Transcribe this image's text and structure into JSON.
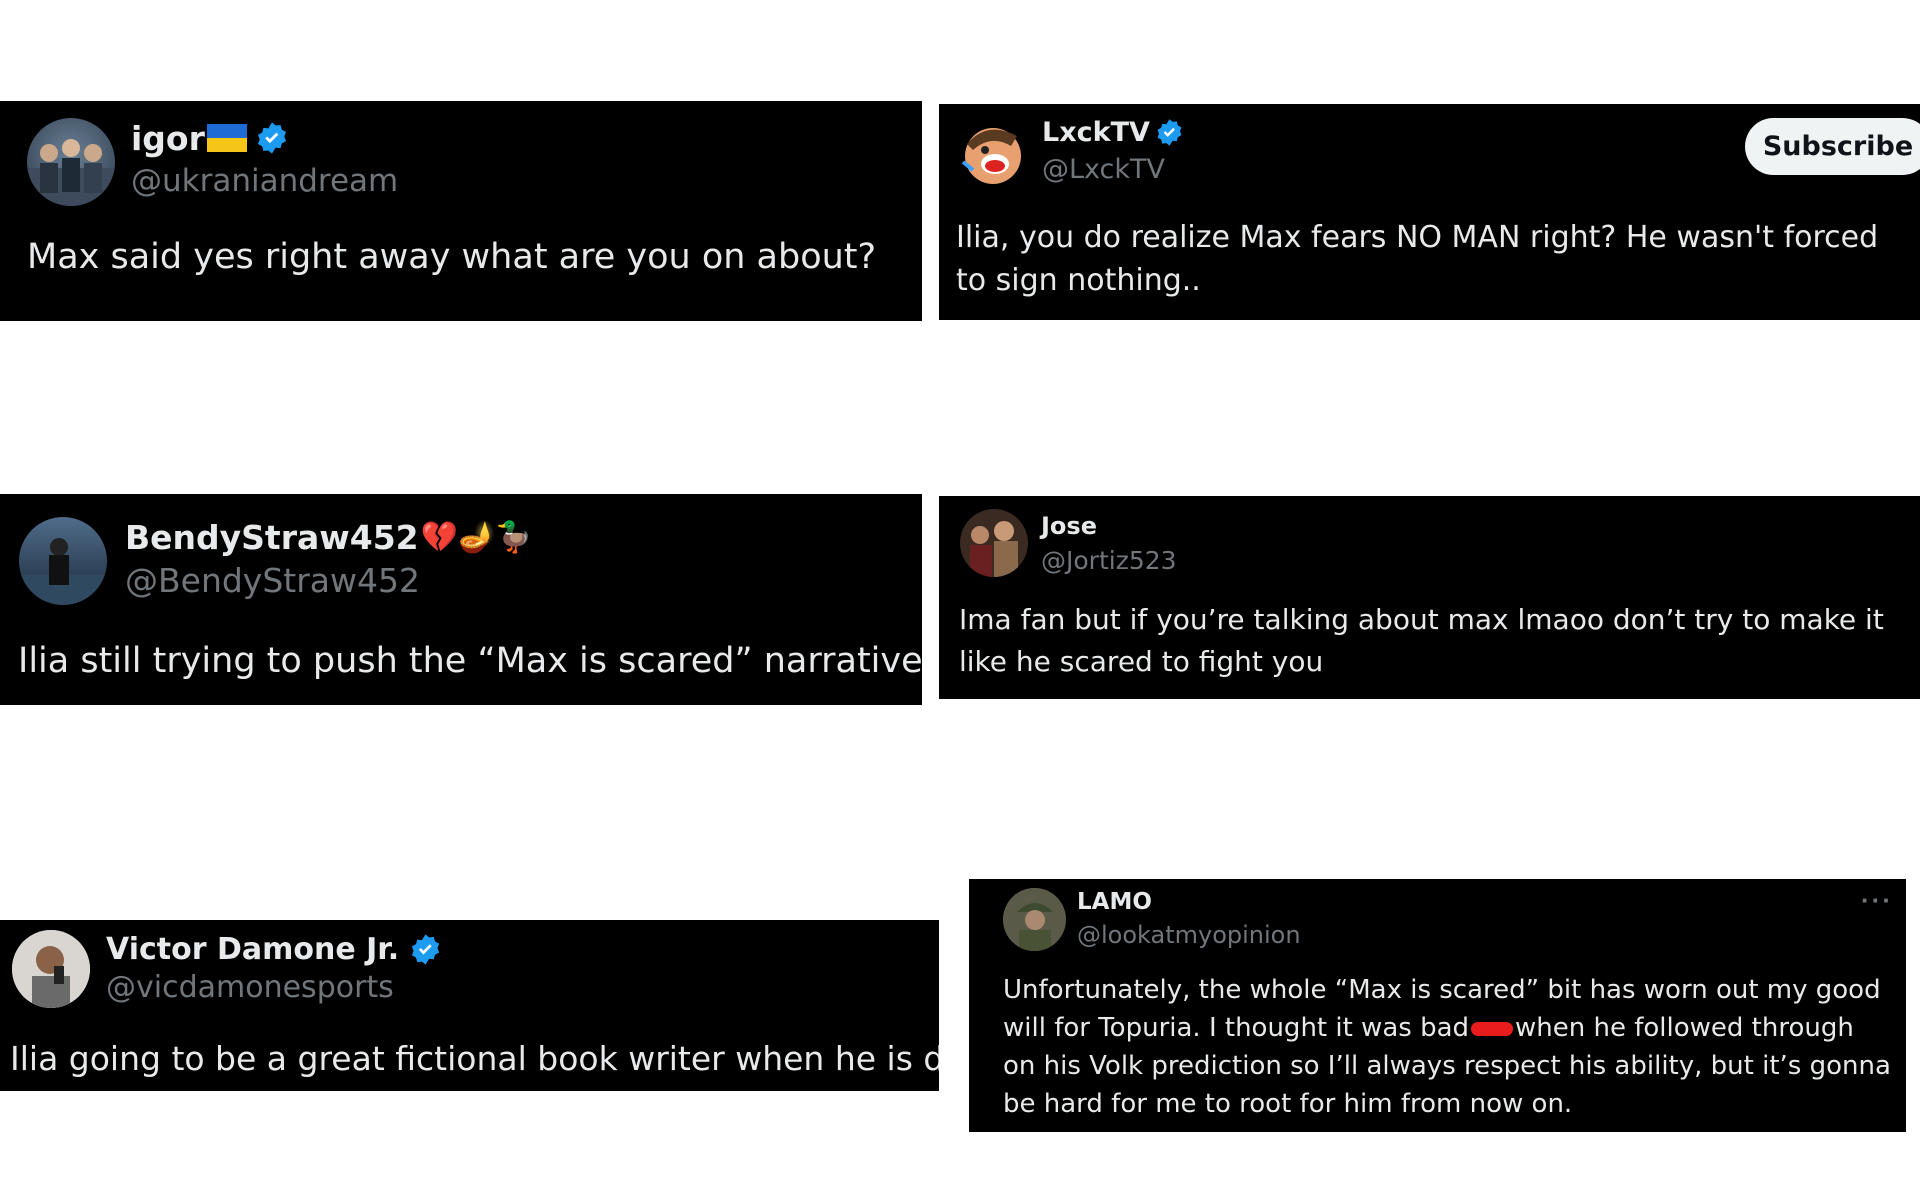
{
  "colors": {
    "card_bg": "#000000",
    "text_primary": "#e7e9ea",
    "text_secondary": "#71767b",
    "verified": "#1d9bf0",
    "page_bg": "#ffffff"
  },
  "tweets": [
    {
      "name": "igor",
      "handle": "@ukraniandream",
      "verified": true,
      "flag": "ukraine-flag-icon",
      "text": "Max said yes right away what are you on about?"
    },
    {
      "name": "LxckTV",
      "handle": "@LxckTV",
      "verified": true,
      "subscribe_label": "Subscribe",
      "text": "Ilia, you do realize Max fears NO MAN right? He wasn't forced to sign nothing.."
    },
    {
      "name": "BendyStraw452",
      "name_emojis": "💔🪔🦆",
      "handle": "@BendyStraw452",
      "verified": false,
      "text": "Ilia still trying to push the “Max is scared” narrative"
    },
    {
      "name": "Jose",
      "handle": "@Jortiz523",
      "verified": false,
      "text": "Ima fan but if you’re talking about max lmaoo don’t try to make it like he scared to fight you"
    },
    {
      "name": "Victor Damone Jr.",
      "handle": "@vicdamonesports",
      "verified": true,
      "text": "Ilia going to be a great fictional book writer when he is done"
    },
    {
      "name": "LAMO",
      "handle": "@lookatmyopinion",
      "verified": false,
      "more_label": "···",
      "text_before_redaction": "Unfortunately, the whole “Max is scared” bit has worn out my good will for Topuria. I thought it was bad",
      "text_after_redaction": "when he followed through on his Volk prediction so I’ll always respect his ability, but it’s gonna be hard for me to root for him from now on."
    }
  ]
}
